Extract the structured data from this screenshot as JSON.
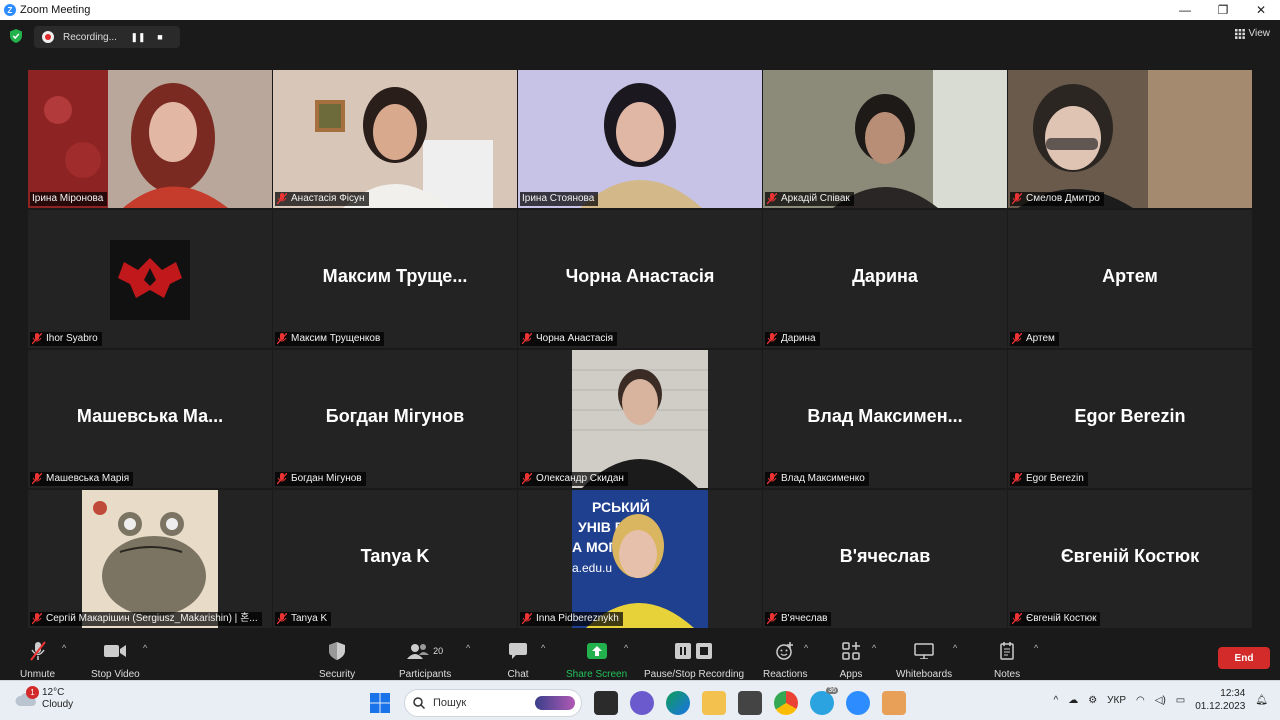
{
  "window": {
    "title": "Zoom Meeting",
    "controls": [
      "—",
      "❐",
      "✕"
    ]
  },
  "topbar": {
    "recording_label": "Recording...",
    "view_label": "View"
  },
  "participants": [
    {
      "tile_name": "Ірина Міронова",
      "display": "",
      "video": true,
      "active": true,
      "muted": false
    },
    {
      "tile_name": "Анастасія Фісун",
      "display": "",
      "video": true,
      "muted": true
    },
    {
      "tile_name": "Ірина Стоянова",
      "display": "",
      "video": true,
      "muted": false
    },
    {
      "tile_name": "Аркадій Співак",
      "display": "",
      "video": true,
      "muted": true
    },
    {
      "tile_name": "Смелов Дмитро",
      "display": "",
      "video": true,
      "muted": true
    },
    {
      "tile_name": "Ihor Syabro",
      "display": "",
      "avatar": "red-logo",
      "muted": true
    },
    {
      "tile_name": "Максим Трущенков",
      "display": "Максим  Трущe...",
      "muted": true
    },
    {
      "tile_name": "Чорна Анастасія",
      "display": "Чорна Анастасія",
      "muted": true
    },
    {
      "tile_name": "Дарина",
      "display": "Дарина",
      "muted": true
    },
    {
      "tile_name": "Артем",
      "display": "Артем",
      "muted": true
    },
    {
      "tile_name": "Машевська Марія",
      "display": "Машевська  Ма...",
      "muted": true
    },
    {
      "tile_name": "Богдан Мігунов",
      "display": "Богдан Мігунов",
      "muted": true
    },
    {
      "tile_name": "Олександр Скидан",
      "display": "",
      "avatar": "photo-man",
      "muted": true
    },
    {
      "tile_name": "Влад Максименко",
      "display": "Влад  Максимен...",
      "muted": true
    },
    {
      "tile_name": "Egor Berezin",
      "display": "Egor Berezin",
      "muted": true
    },
    {
      "tile_name": "Сергій Макарішин (Sergiusz_Makarishin) | 혼...",
      "display": "",
      "avatar": "frog",
      "muted": true
    },
    {
      "tile_name": "Tanya K",
      "display": "Tanya K",
      "muted": true
    },
    {
      "tile_name": "Inna Pidbereznykh",
      "display": "",
      "avatar": "photo-woman",
      "muted": true
    },
    {
      "tile_name": "В'ячеслав",
      "display": "В'ячеслав",
      "muted": true
    },
    {
      "tile_name": "Євгеній Костюк",
      "display": "Євгеній Костюк",
      "muted": true
    }
  ],
  "avatar_text": {
    "university_line1": "РСЬКИЙ",
    "university_line2": "УНІВ    ЕТ",
    "university_line3": "А МОГ",
    "university_line4": "a.edu.u"
  },
  "toolbar": {
    "unmute": "Unmute",
    "stop_video": "Stop Video",
    "security": "Security",
    "participants": "Participants",
    "participants_count": "20",
    "chat": "Chat",
    "share_screen": "Share Screen",
    "pause_stop_recording": "Pause/Stop Recording",
    "reactions": "Reactions",
    "apps": "Apps",
    "whiteboards": "Whiteboards",
    "notes": "Notes",
    "end": "End"
  },
  "taskbar": {
    "temperature": "12°C",
    "weather": "Cloudy",
    "weather_badge": "1",
    "search_placeholder": "Пошук",
    "telegram_badge": "36",
    "language": "УКР",
    "time": "12:34",
    "date": "01.12.2023"
  },
  "colors": {
    "active_speaker_border": "#d3e14e",
    "end_button": "#d32a2a",
    "share_green": "#22b14c",
    "accent": "#2d8cff"
  }
}
